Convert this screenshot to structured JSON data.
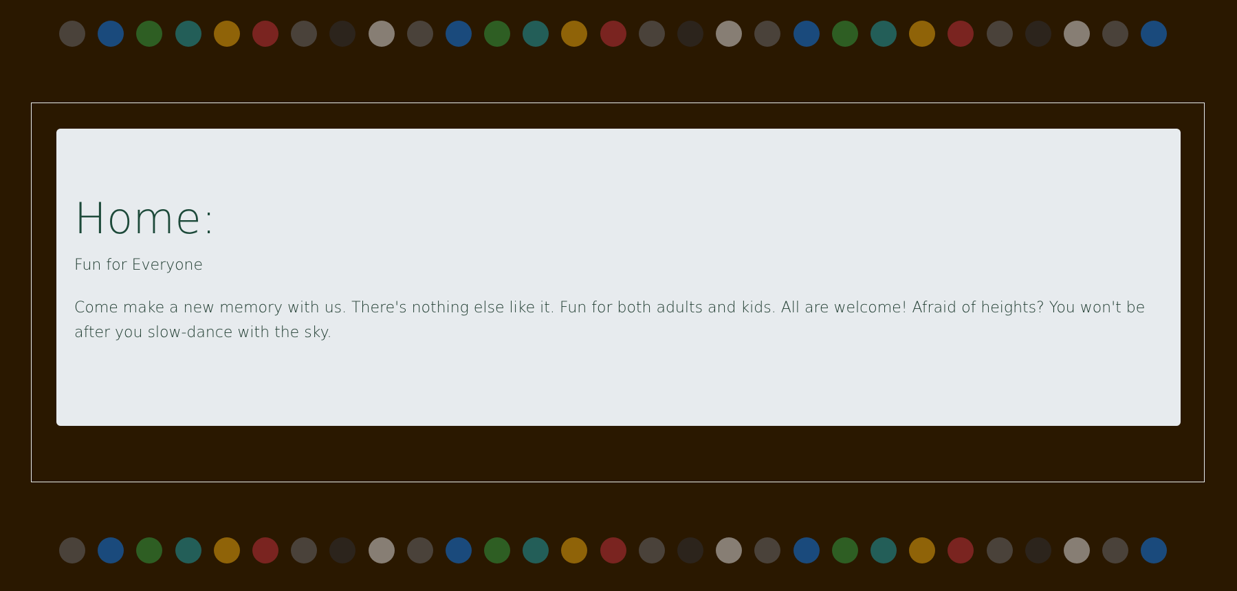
{
  "palette": {
    "background": "#2a1800",
    "card": "#e7ebee",
    "heading": "#1d4a3a",
    "text": "#1d3a2e",
    "frame_border": "#e8ecef"
  },
  "dots": {
    "top": [
      "#4a423a",
      "#1a4a7c",
      "#2e5e23",
      "#235e58",
      "#8f6308",
      "#7a2420",
      "#4a423a",
      "#2c241c",
      "#877e74",
      "#4a423a",
      "#1a4a7c",
      "#2e5e23",
      "#235e58",
      "#8f6308",
      "#7a2420",
      "#4a423a",
      "#2c241c",
      "#877e74",
      "#4a423a",
      "#1a4a7c",
      "#2e5e23",
      "#235e58",
      "#8f6308",
      "#7a2420",
      "#4a423a",
      "#2c241c",
      "#877e74",
      "#4a423a",
      "#1a4a7c"
    ],
    "bottom": [
      "#4a423a",
      "#1a4a7c",
      "#2e5e23",
      "#235e58",
      "#8f6308",
      "#7a2420",
      "#4a423a",
      "#2c241c",
      "#877e74",
      "#4a423a",
      "#1a4a7c",
      "#2e5e23",
      "#235e58",
      "#8f6308",
      "#7a2420",
      "#4a423a",
      "#2c241c",
      "#877e74",
      "#4a423a",
      "#1a4a7c",
      "#2e5e23",
      "#235e58",
      "#8f6308",
      "#7a2420",
      "#4a423a",
      "#2c241c",
      "#877e74",
      "#4a423a",
      "#1a4a7c"
    ]
  },
  "content": {
    "title": "Home:",
    "subtitle": "Fun for Everyone",
    "body": "Come make a new memory with us. There's nothing else like it. Fun for both adults and kids. All are welcome! Afraid of heights? You won't be after you slow-dance with the sky."
  }
}
